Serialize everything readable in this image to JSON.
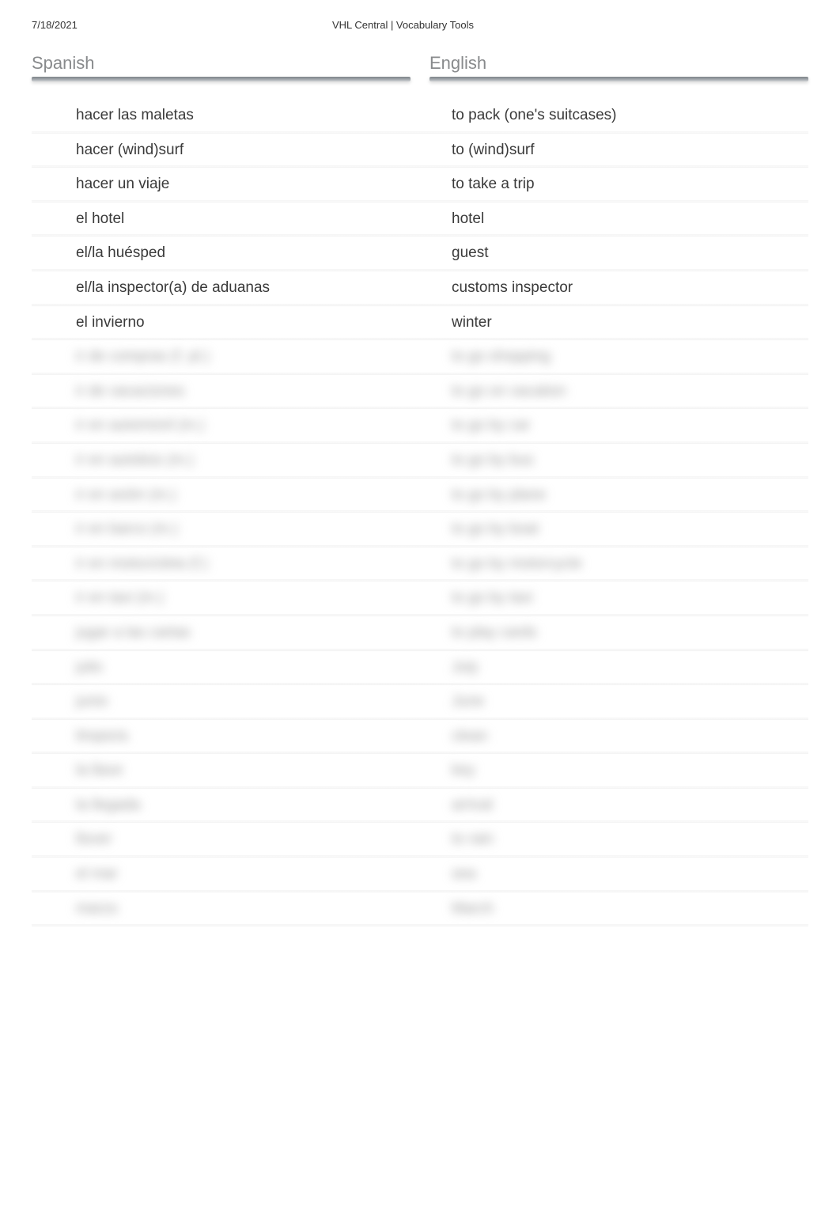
{
  "meta": {
    "date": "7/18/2021",
    "title": "VHL Central | Vocabulary Tools"
  },
  "headers": {
    "left": "Spanish",
    "right": "English"
  },
  "rows": [
    {
      "spanish": "hacer las maletas",
      "english": "to pack (one's suitcases)",
      "blurred": false
    },
    {
      "spanish": "hacer (wind)surf",
      "english": "to (wind)surf",
      "blurred": false
    },
    {
      "spanish": "hacer un viaje",
      "english": "to take a trip",
      "blurred": false
    },
    {
      "spanish": "el hotel",
      "english": "hotel",
      "blurred": false
    },
    {
      "spanish": "el/la huésped",
      "english": "guest",
      "blurred": false
    },
    {
      "spanish": "el/la inspector(a) de aduanas",
      "english": "customs inspector",
      "blurred": false
    },
    {
      "spanish": "el invierno",
      "english": "winter",
      "blurred": false
    },
    {
      "spanish": "ir de compras (f. pl.)",
      "english": "to go shopping",
      "blurred": true
    },
    {
      "spanish": "ir de vacaciones",
      "english": "to go on vacation",
      "blurred": true
    },
    {
      "spanish": "ir en automóvil (m.)",
      "english": "to go by car",
      "blurred": true
    },
    {
      "spanish": "ir en autobús (m.)",
      "english": "to go by bus",
      "blurred": true
    },
    {
      "spanish": "ir en avión (m.)",
      "english": "to go by plane",
      "blurred": true
    },
    {
      "spanish": "ir en barco (m.)",
      "english": "to go by boat",
      "blurred": true
    },
    {
      "spanish": "ir en motocicleta (f.)",
      "english": "to go by motorcycle",
      "blurred": true
    },
    {
      "spanish": "ir en taxi (m.)",
      "english": "to go by taxi",
      "blurred": true
    },
    {
      "spanish": "jugar a las cartas",
      "english": "to play cards",
      "blurred": true
    },
    {
      "spanish": "julio",
      "english": "July",
      "blurred": true
    },
    {
      "spanish": "junio",
      "english": "June",
      "blurred": true
    },
    {
      "spanish": "limpio/a",
      "english": "clean",
      "blurred": true
    },
    {
      "spanish": "la llave",
      "english": "key",
      "blurred": true
    },
    {
      "spanish": "la llegada",
      "english": "arrival",
      "blurred": true
    },
    {
      "spanish": "llover",
      "english": "to rain",
      "blurred": true
    },
    {
      "spanish": "el mar",
      "english": "sea",
      "blurred": true
    },
    {
      "spanish": "marzo",
      "english": "March",
      "blurred": true
    }
  ]
}
